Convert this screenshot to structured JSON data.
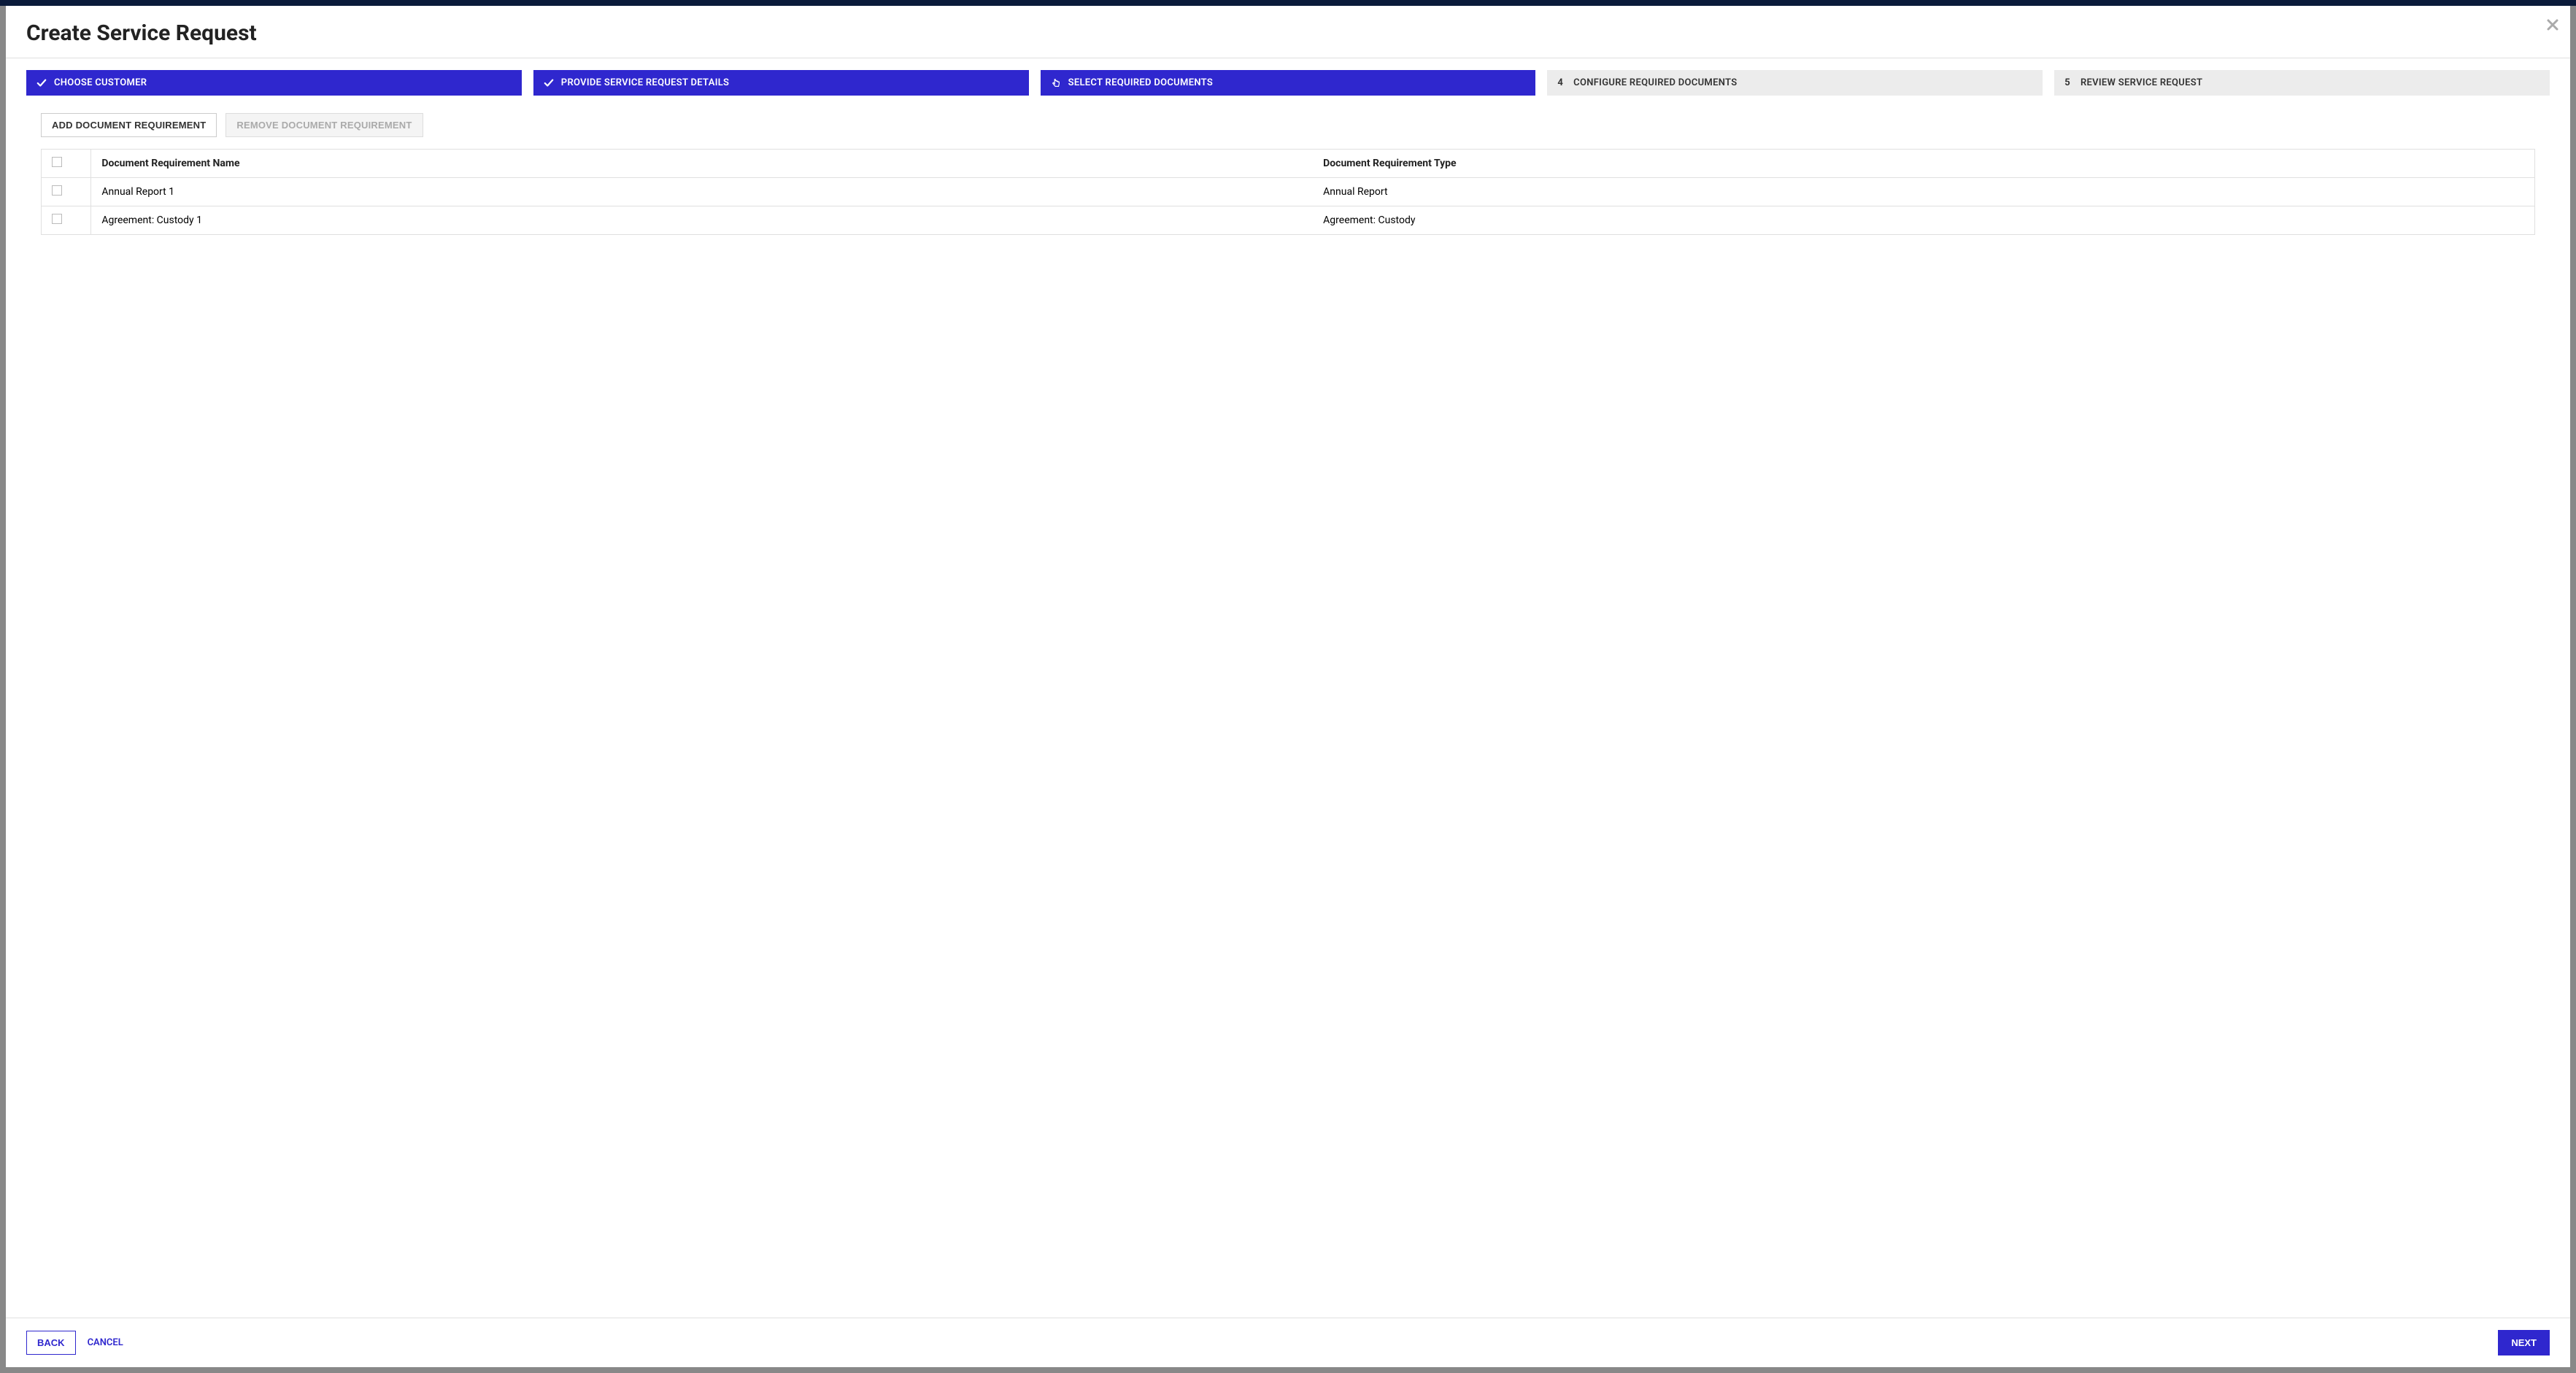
{
  "modal": {
    "title": "Create Service Request"
  },
  "wizard": {
    "steps": [
      {
        "label": "CHOOSE CUSTOMER",
        "status": "completed"
      },
      {
        "label": "PROVIDE SERVICE REQUEST DETAILS",
        "status": "completed"
      },
      {
        "label": "SELECT REQUIRED DOCUMENTS",
        "status": "active"
      },
      {
        "number": "4",
        "label": "CONFIGURE REQUIRED DOCUMENTS",
        "status": "pending"
      },
      {
        "number": "5",
        "label": "REVIEW SERVICE REQUEST",
        "status": "pending"
      }
    ]
  },
  "actions": {
    "add": "ADD DOCUMENT REQUIREMENT",
    "remove": "REMOVE DOCUMENT REQUIREMENT"
  },
  "table": {
    "headers": {
      "name": "Document Requirement Name",
      "type": "Document Requirement Type"
    },
    "rows": [
      {
        "name": "Annual Report 1",
        "type": "Annual Report"
      },
      {
        "name": "Agreement: Custody 1",
        "type": "Agreement: Custody"
      }
    ]
  },
  "footer": {
    "back": "BACK",
    "cancel": "CANCEL",
    "next": "NEXT"
  }
}
